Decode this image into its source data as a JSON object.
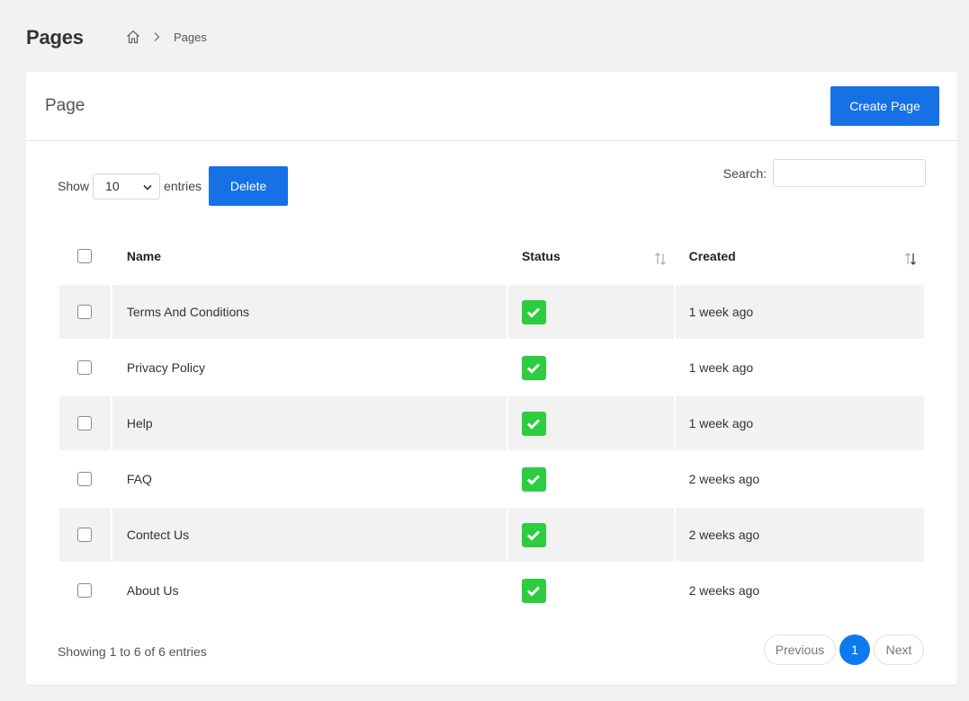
{
  "header": {
    "title": "Pages",
    "breadcrumb": [
      "Pages"
    ]
  },
  "card": {
    "title": "Page",
    "create_label": "Create Page"
  },
  "controls": {
    "show_label": "Show",
    "entries_value": "10",
    "entries_label": "entries",
    "delete_label": "Delete",
    "search_label": "Search:",
    "search_value": ""
  },
  "table": {
    "columns": [
      "Name",
      "Status",
      "Created"
    ],
    "rows": [
      {
        "name": "Terms And Conditions",
        "status": "active",
        "created": "1 week ago"
      },
      {
        "name": "Privacy Policy",
        "status": "active",
        "created": "1 week ago"
      },
      {
        "name": "Help",
        "status": "active",
        "created": "1 week ago"
      },
      {
        "name": "FAQ",
        "status": "active",
        "created": "2 weeks ago"
      },
      {
        "name": "Contect Us",
        "status": "active",
        "created": "2 weeks ago"
      },
      {
        "name": "About Us",
        "status": "active",
        "created": "2 weeks ago"
      }
    ]
  },
  "footer": {
    "info": "Showing 1 to 6 of 6 entries",
    "previous_label": "Previous",
    "current_page": "1",
    "next_label": "Next"
  },
  "colors": {
    "primary": "#1670e6",
    "success": "#2ecc40",
    "page_active": "#0d7af0"
  }
}
